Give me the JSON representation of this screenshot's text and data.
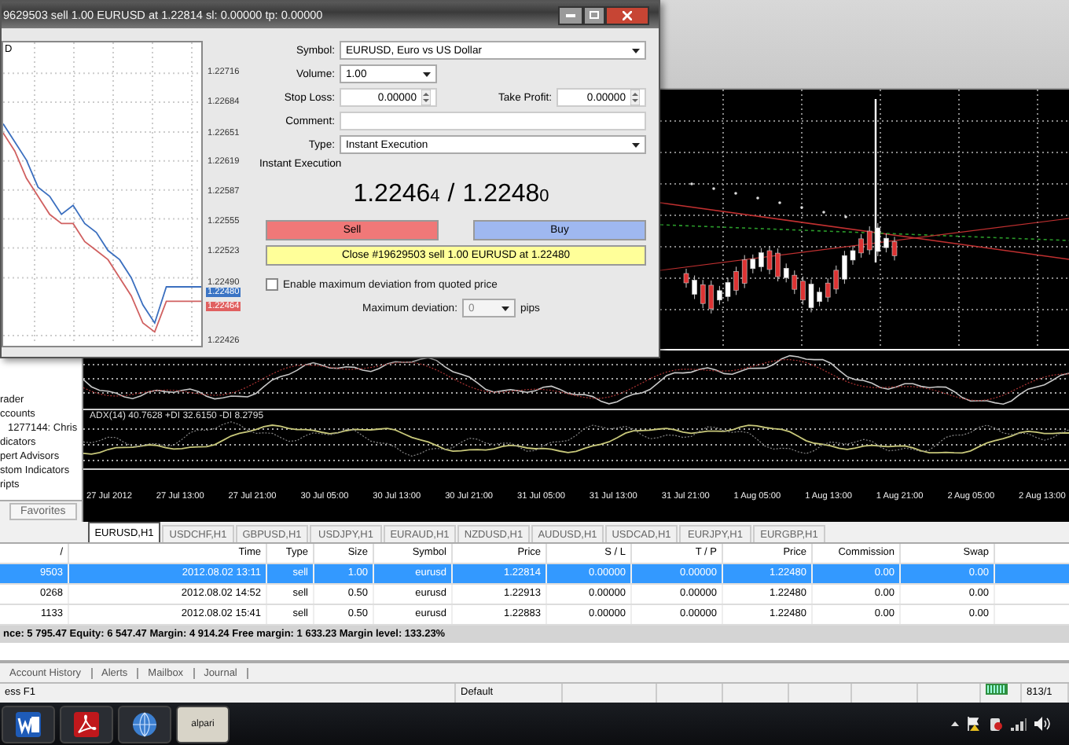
{
  "dialog": {
    "title": "9629503 sell 1.00 EURUSD at 1.22814 sl: 0.00000 tp: 0.00000",
    "chart": {
      "label": "D",
      "ask_tag": "1.22480",
      "bid_tag": "1.22464",
      "chart_data": {
        "type": "line",
        "grid": true,
        "ylim": [
          1.2242,
          1.2275
        ],
        "yticks": [
          {
            "value": 1.22716,
            "label": "1.22716"
          },
          {
            "value": 1.22684,
            "label": "1.22684"
          },
          {
            "value": 1.22651,
            "label": "1.22651"
          },
          {
            "value": 1.22619,
            "label": "1.22619"
          },
          {
            "value": 1.22587,
            "label": "1.22587"
          },
          {
            "value": 1.22555,
            "label": "1.22555"
          },
          {
            "value": 1.22523,
            "label": "1.22523"
          },
          {
            "value": 1.2249,
            "label": "1.22490"
          },
          {
            "value": 1.22426,
            "label": "1.22426"
          }
        ],
        "series": [
          {
            "color": "#3b6fbf",
            "values": [
              1.2266,
              1.2264,
              1.2262,
              1.2259,
              1.2258,
              1.2256,
              1.2257,
              1.2255,
              1.2254,
              1.2252,
              1.2251,
              1.2249,
              1.2246,
              1.2244,
              1.2248,
              1.2248,
              1.2248,
              1.2248
            ]
          },
          {
            "color": "#d06060",
            "values": [
              1.2265,
              1.2263,
              1.226,
              1.2258,
              1.2256,
              1.2255,
              1.2255,
              1.2253,
              1.2252,
              1.2251,
              1.2249,
              1.2247,
              1.2244,
              1.2243,
              1.22464,
              1.22464,
              1.22464,
              1.22464
            ]
          }
        ]
      }
    },
    "symbol": {
      "label": "Symbol:",
      "value": "EURUSD, Euro vs US Dollar"
    },
    "volume": {
      "label": "Volume:",
      "value": "1.00"
    },
    "stop_loss": {
      "label": "Stop Loss:",
      "value": "0.00000"
    },
    "take_profit": {
      "label": "Take Profit:",
      "value": "0.00000"
    },
    "comment": {
      "label": "Comment:"
    },
    "type": {
      "label": "Type:",
      "value": "Instant Execution"
    },
    "group_title": "Instant Execution",
    "quote": {
      "bid": "1.2246",
      "bid_last": "4",
      "separator": "/",
      "ask": "1.2248",
      "ask_last": "0"
    },
    "sell_button": "Sell",
    "buy_button": "Buy",
    "close_button": "Close #19629503 sell 1.00 EURUSD at 1.22480",
    "deviation_checkbox": {
      "label": "Enable maximum deviation from quoted price",
      "checked": false
    },
    "max_deviation": {
      "label": "Maximum deviation:",
      "value": "0",
      "unit": "pips",
      "disabled": true
    }
  },
  "navigator": {
    "items": [
      {
        "label": "rader"
      },
      {
        "label": "ccounts",
        "children": [
          {
            "label": "1277144: Chris"
          }
        ]
      },
      {
        "label": "dicators"
      },
      {
        "label": "pert Advisors"
      },
      {
        "label": "stom Indicators"
      },
      {
        "label": "ripts"
      }
    ],
    "tab": "Favorites"
  },
  "chart": {
    "indicator_label": "ADX(14) 40.7628 +DI 32.6150 -DI 8.2795",
    "time_axis": [
      "27 Jul 2012",
      "27 Jul 13:00",
      "27 Jul 21:00",
      "30 Jul 05:00",
      "30 Jul 13:00",
      "30 Jul 21:00",
      "31 Jul 05:00",
      "31 Jul 13:00",
      "31 Jul 21:00",
      "1 Aug 05:00",
      "1 Aug 13:00",
      "1 Aug 21:00",
      "2 Aug 05:00",
      "2 Aug 13:00"
    ]
  },
  "chart_tabs": [
    {
      "label": "EURUSD,H1",
      "selected": true
    },
    {
      "label": "USDCHF,H1",
      "selected": false
    },
    {
      "label": "GBPUSD,H1",
      "selected": false
    },
    {
      "label": "USDJPY,H1",
      "selected": false
    },
    {
      "label": "EURAUD,H1",
      "selected": false
    },
    {
      "label": "NZDUSD,H1",
      "selected": false
    },
    {
      "label": "AUDUSD,H1",
      "selected": false
    },
    {
      "label": "USDCAD,H1",
      "selected": false
    },
    {
      "label": "EURJPY,H1",
      "selected": false
    },
    {
      "label": "EURGBP,H1",
      "selected": false
    }
  ],
  "trade_table": {
    "columns": [
      "/",
      "Time",
      "Type",
      "Size",
      "Symbol",
      "Price",
      "S / L",
      "T / P",
      "Price",
      "Commission",
      "Swap"
    ],
    "rows": [
      {
        "selected": true,
        "cells": [
          "9503",
          "2012.08.02 13:11",
          "sell",
          "1.00",
          "eurusd",
          "1.22814",
          "0.00000",
          "0.00000",
          "1.22480",
          "0.00",
          "0.00"
        ]
      },
      {
        "selected": false,
        "cells": [
          "0268",
          "2012.08.02 14:52",
          "sell",
          "0.50",
          "eurusd",
          "1.22913",
          "0.00000",
          "0.00000",
          "1.22480",
          "0.00",
          "0.00"
        ]
      },
      {
        "selected": false,
        "cells": [
          "1133",
          "2012.08.02 15:41",
          "sell",
          "0.50",
          "eurusd",
          "1.22883",
          "0.00000",
          "0.00000",
          "1.22480",
          "0.00",
          "0.00"
        ]
      }
    ],
    "summary": "nce: 5 795.47  Equity: 6 547.47  Margin: 4 914.24  Free margin: 1 633.23  Margin level: 133.23%"
  },
  "terminal_tabs": [
    "Account History",
    "Alerts",
    "Mailbox",
    "Journal"
  ],
  "status_bar": {
    "help": "ess F1",
    "profile": "Default",
    "traffic": "813/1"
  },
  "taskbar": [
    {
      "kind": "word"
    },
    {
      "kind": "pdf"
    },
    {
      "kind": "browser"
    },
    {
      "kind": "alpari",
      "label": "alpari"
    }
  ]
}
